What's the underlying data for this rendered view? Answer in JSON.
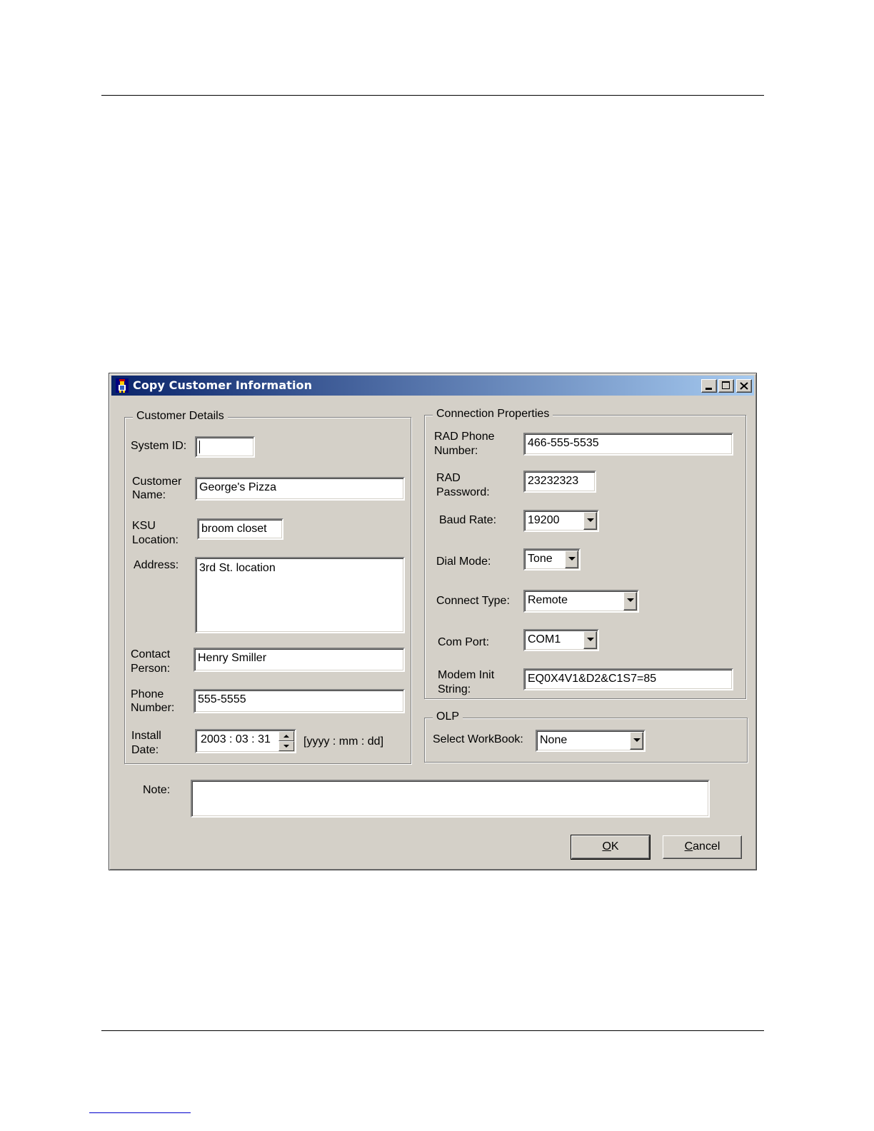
{
  "window": {
    "title": "Copy Customer Information"
  },
  "customer_details": {
    "legend": "Customer Details",
    "system_id": {
      "label": "System ID:",
      "value": ""
    },
    "customer_name": {
      "label_line1": "Customer",
      "label_line2": "Name:",
      "value": "George's Pizza"
    },
    "ksu_location": {
      "label_line1": "KSU",
      "label_line2": "Location:",
      "value": "broom closet"
    },
    "address": {
      "label": "Address:",
      "value": "3rd St. location"
    },
    "contact_person": {
      "label_line1": "Contact",
      "label_line2": "Person:",
      "value": "Henry Smiller"
    },
    "phone_number": {
      "label_line1": "Phone",
      "label_line2": "Number:",
      "value": "555-5555"
    },
    "install_date": {
      "label_line1": "Install",
      "label_line2": "Date:",
      "value": "2003 : 03 : 31",
      "format_hint": "[yyyy : mm : dd]"
    }
  },
  "connection_properties": {
    "legend": "Connection Properties",
    "rad_phone": {
      "label_line1": "RAD Phone",
      "label_line2": "Number:",
      "value": "466-555-5535"
    },
    "rad_password": {
      "label_line1": "RAD",
      "label_line2": "Password:",
      "value": "23232323"
    },
    "baud_rate": {
      "label": "Baud Rate:",
      "value": "19200"
    },
    "dial_mode": {
      "label": "Dial Mode:",
      "value": "Tone"
    },
    "connect_type": {
      "label": "Connect Type:",
      "value": "Remote"
    },
    "com_port": {
      "label": "Com Port:",
      "value": "COM1"
    },
    "modem_init": {
      "label_line1": "Modem Init",
      "label_line2": "String:",
      "value": "EQ0X4V1&D2&C1S7=85"
    }
  },
  "olp": {
    "legend": "OLP",
    "select_workbook": {
      "label": "Select WorkBook:",
      "value": "None"
    }
  },
  "note": {
    "label": "Note:",
    "value": ""
  },
  "buttons": {
    "ok_hotkey": "O",
    "ok_rest": "K",
    "cancel_hotkey": "C",
    "cancel_rest": "ancel"
  },
  "colors": {
    "titlebar_start": "#0a246a",
    "titlebar_end": "#a6caf0",
    "dialog_face": "#d4d0c8"
  }
}
